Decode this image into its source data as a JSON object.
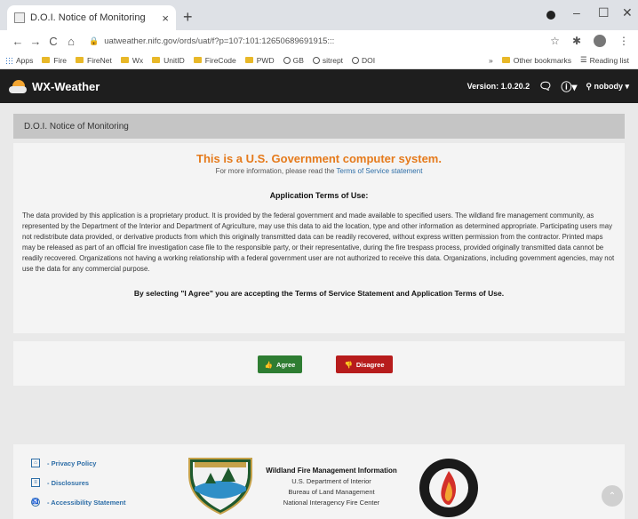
{
  "browser": {
    "tab_title": "D.O.I. Notice of Monitoring",
    "tab_close": "×",
    "new_tab": "+",
    "url": "uatweather.nifc.gov/ords/uat/f?p=107:101:12650689691915:::",
    "window_controls": {
      "minimize": "–",
      "maximize": "☐",
      "close": "✕"
    },
    "nav": {
      "back": "←",
      "forward": "→",
      "reload": "C",
      "home": "⌂"
    },
    "bookmarks": [
      "Apps",
      "Fire",
      "FireNet",
      "Wx",
      "UnitID",
      "FireCode",
      "PWD",
      "GB",
      "sitrept",
      "DOI"
    ],
    "bookmarks_more": "»",
    "other_bookmarks": "Other bookmarks",
    "reading_list": "Reading list"
  },
  "app": {
    "name": "WX-Weather",
    "version": "Version: 1.0.20.2",
    "user": "nobody",
    "icons": {
      "chat": "chat-icon",
      "help": "help-icon",
      "user": "user-icon"
    }
  },
  "page": {
    "title": "D.O.I. Notice of Monitoring",
    "headline": "This is a U.S. Government computer system.",
    "more_info_prefix": "For more information, please read the",
    "more_info_link": "Terms of Service statement",
    "terms_heading": "Application Terms of Use:",
    "terms_body": "The data provided by this application is a proprietary product. It is provided by the federal government and made available to specified users. The wildland fire management community, as represented by the Department of the Interior and Department of Agriculture, may use this data to aid the location, type and other information as determined appropriate. Participating users may not redistribute data provided, or derivative products from which this originally transmitted data can be readily recovered, without express written permission from the contractor. Printed maps may be released as part of an official fire investigation case file to the responsible party, or their representative, during the fire trespass process, provided originally transmitted data cannot be readily recovered. Organizations not having a working relationship with a federal government user are not authorized to receive this data. Organizations, including government agencies, may not use the data for any commercial purpose.",
    "agree_statement": "By selecting \"I Agree\" you are accepting the Terms of Service Statement and Application Terms of Use.",
    "agree_label": "Agree",
    "disagree_label": "Disagree"
  },
  "footer": {
    "links": [
      "- Privacy Policy",
      "- Disclosures",
      "- Accessibility Statement"
    ],
    "agency_title": "Wildland Fire Management Information",
    "agency_lines": [
      "U.S. Department of Interior",
      "Bureau of Land Management",
      "National Interagency Fire Center"
    ]
  },
  "colors": {
    "headline_orange": "#e57a1b",
    "agree_green": "#2e7d32",
    "disagree_red": "#b71c1c",
    "link_blue": "#2e6ea7",
    "appbar": "#1e1e1e"
  }
}
